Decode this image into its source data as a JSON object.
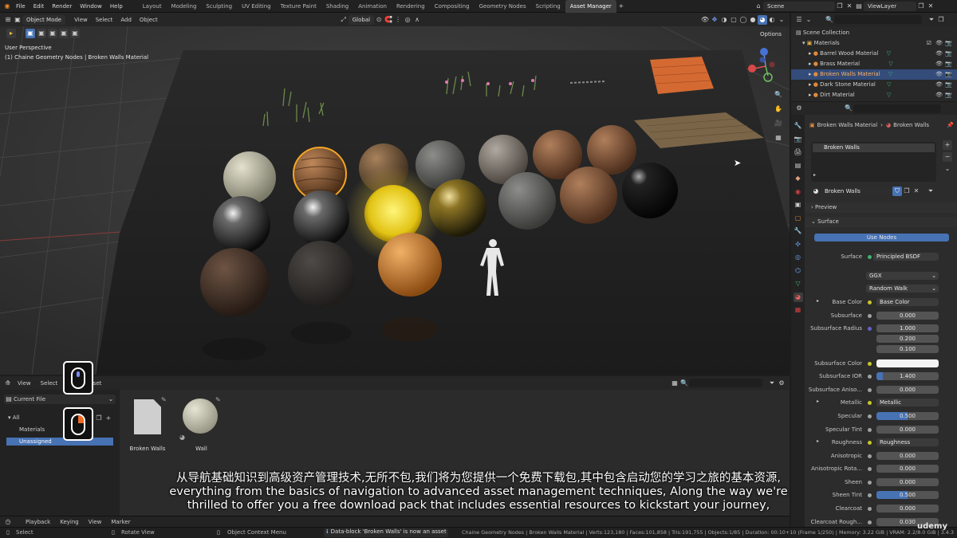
{
  "menu": [
    "File",
    "Edit",
    "Render",
    "Window",
    "Help"
  ],
  "workspaces": [
    "Layout",
    "Modeling",
    "Sculpting",
    "UV Editing",
    "Texture Paint",
    "Shading",
    "Animation",
    "Rendering",
    "Compositing",
    "Geometry Nodes",
    "Scripting",
    "Asset Manager"
  ],
  "active_workspace": "Asset Manager",
  "scene": "Scene",
  "view_layer": "ViewLayer",
  "viewport": {
    "mode": "Object Mode",
    "menus": [
      "View",
      "Select",
      "Add",
      "Object"
    ],
    "transform": "Global",
    "options": "Options",
    "title": "User Perspective",
    "subtitle": "(1) Chaine Geometry Nodes | Broken Walls Material"
  },
  "asset_browser": {
    "menus": [
      "View",
      "Select",
      "Asset"
    ],
    "library": "Current File",
    "tree": {
      "all": "All",
      "materials": "Materials",
      "unassigned": "Unassigned"
    },
    "items": [
      {
        "label": "Broken Walls"
      },
      {
        "label": "Wall"
      }
    ]
  },
  "timeline": {
    "menus": [
      "Playback",
      "Keying",
      "View",
      "Marker"
    ]
  },
  "status": {
    "select": "Select",
    "rotate": "Rotate View",
    "context": "Object Context Menu",
    "message": "Data-block 'Broken Walls' is now an asset",
    "stats": "Chaine Geometry Nodes | Broken Walls Material | Verts:123,180 | Faces:101,858 | Tris:191,755 | Objects:1/85 | Duration: 00:10+10 (Frame 1/250) | Memory: 3.22 GiB | VRAM: 2.2/8.0 GiB | 3.4.3"
  },
  "outliner": {
    "collection": "Scene Collection",
    "folder": "Materials",
    "rows": [
      "Barrel Wood Material",
      "Brass Material",
      "Broken Walls Material",
      "Dark Stone Material",
      "Dirt Material"
    ],
    "selected": "Broken Walls Material"
  },
  "properties": {
    "breadcrumb_object": "Broken Walls Material",
    "breadcrumb_material": "Broken Walls",
    "slot": "Broken Walls",
    "material_name": "Broken Walls",
    "preview": "Preview",
    "surface_panel": "Surface",
    "use_nodes": "Use Nodes",
    "surface_label": "Surface",
    "surface_value": "Principled BSDF",
    "distribution": "GGX",
    "subsurface_method": "Random Walk",
    "rows": [
      {
        "label": "Base Color",
        "value": "Base Color",
        "kind": "link"
      },
      {
        "label": "Subsurface",
        "value": "0.000"
      },
      {
        "label": "Subsurface Radius",
        "value": "1.000"
      },
      {
        "label": "",
        "value": "0.200"
      },
      {
        "label": "",
        "value": "0.100"
      },
      {
        "label": "Subsurface Color",
        "value": "",
        "kind": "color"
      },
      {
        "label": "Subsurface IOR",
        "value": "1.400",
        "fill": 0.1
      },
      {
        "label": "Subsurface Aniso...",
        "value": "0.000"
      },
      {
        "label": "Metallic",
        "value": "Metallic",
        "kind": "link"
      },
      {
        "label": "Specular",
        "value": "0.500",
        "fill": 0.5
      },
      {
        "label": "Specular Tint",
        "value": "0.000"
      },
      {
        "label": "Roughness",
        "value": "Roughness",
        "kind": "link"
      },
      {
        "label": "Anisotropic",
        "value": "0.000"
      },
      {
        "label": "Anisotropic Rota...",
        "value": "0.000"
      },
      {
        "label": "Sheen",
        "value": "0.000"
      },
      {
        "label": "Sheen Tint",
        "value": "0.500",
        "fill": 0.5
      },
      {
        "label": "Clearcoat",
        "value": "0.000"
      },
      {
        "label": "Clearcoat Rough...",
        "value": "0.030"
      }
    ]
  },
  "subtitles": {
    "zh": "从导航基础知识到高级资产管理技术,无所不包,我们将为您提供一个免费下载包,其中包含启动您的学习之旅的基本资源,",
    "en1": "everything from the basics of navigation to advanced asset management techniques, Along the way we're",
    "en2": "thrilled to offer you a free download pack that includes essential resources to kickstart your journey,"
  },
  "watermark": "udemy",
  "colors": {
    "accent": "#4772b3",
    "selected": "#334c7a",
    "orange": "#e8a23a",
    "green": "#3cb371"
  }
}
